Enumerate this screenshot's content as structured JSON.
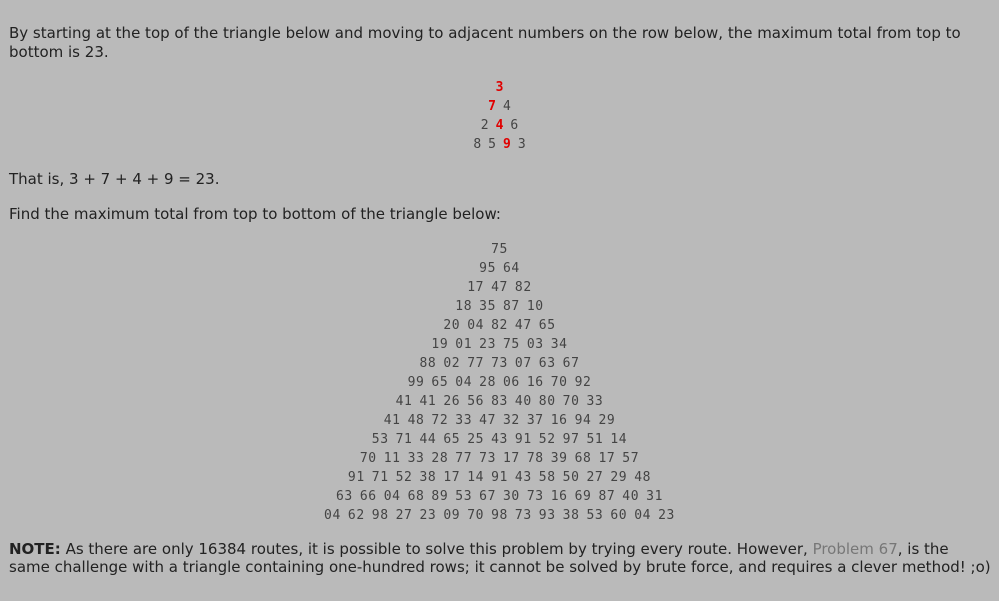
{
  "intro": "By starting at the top of the triangle below and moving to adjacent numbers on the row below, the maximum total from top to bottom is 23.",
  "example_triangle": [
    [
      {
        "v": "3",
        "hl": true
      }
    ],
    [
      {
        "v": "7",
        "hl": true
      },
      {
        "v": "4",
        "hl": false
      }
    ],
    [
      {
        "v": "2",
        "hl": false
      },
      {
        "v": "4",
        "hl": true
      },
      {
        "v": "6",
        "hl": false
      }
    ],
    [
      {
        "v": "8",
        "hl": false
      },
      {
        "v": "5",
        "hl": false
      },
      {
        "v": "9",
        "hl": true
      },
      {
        "v": "3",
        "hl": false
      }
    ]
  ],
  "that_is": "That is, 3 + 7 + 4 + 9 = 23.",
  "find": "Find the maximum total from top to bottom of the triangle below:",
  "triangle": [
    [
      "75"
    ],
    [
      "95",
      "64"
    ],
    [
      "17",
      "47",
      "82"
    ],
    [
      "18",
      "35",
      "87",
      "10"
    ],
    [
      "20",
      "04",
      "82",
      "47",
      "65"
    ],
    [
      "19",
      "01",
      "23",
      "75",
      "03",
      "34"
    ],
    [
      "88",
      "02",
      "77",
      "73",
      "07",
      "63",
      "67"
    ],
    [
      "99",
      "65",
      "04",
      "28",
      "06",
      "16",
      "70",
      "92"
    ],
    [
      "41",
      "41",
      "26",
      "56",
      "83",
      "40",
      "80",
      "70",
      "33"
    ],
    [
      "41",
      "48",
      "72",
      "33",
      "47",
      "32",
      "37",
      "16",
      "94",
      "29"
    ],
    [
      "53",
      "71",
      "44",
      "65",
      "25",
      "43",
      "91",
      "52",
      "97",
      "51",
      "14"
    ],
    [
      "70",
      "11",
      "33",
      "28",
      "77",
      "73",
      "17",
      "78",
      "39",
      "68",
      "17",
      "57"
    ],
    [
      "91",
      "71",
      "52",
      "38",
      "17",
      "14",
      "91",
      "43",
      "58",
      "50",
      "27",
      "29",
      "48"
    ],
    [
      "63",
      "66",
      "04",
      "68",
      "89",
      "53",
      "67",
      "30",
      "73",
      "16",
      "69",
      "87",
      "40",
      "31"
    ],
    [
      "04",
      "62",
      "98",
      "27",
      "23",
      "09",
      "70",
      "98",
      "73",
      "93",
      "38",
      "53",
      "60",
      "04",
      "23"
    ]
  ],
  "note": {
    "label": "NOTE:",
    "text_before": " As there are only 16384 routes, it is possible to solve this problem by trying every route. However, ",
    "link_text": "Problem 67",
    "text_after": ", is the same challenge with a triangle containing one-hundred rows; it cannot be solved by brute force, and requires a clever method! ;o)"
  },
  "colors": {
    "background": "#bababa",
    "text": "#222222",
    "highlight": "#e00000",
    "link": "#777777"
  }
}
